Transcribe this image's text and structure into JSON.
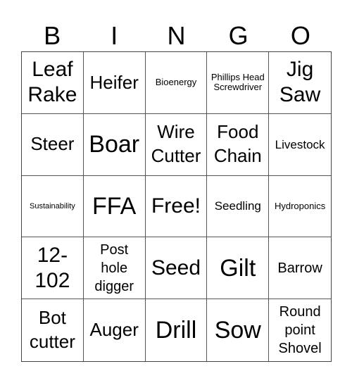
{
  "header": [
    "B",
    "I",
    "N",
    "G",
    "O"
  ],
  "cells": [
    {
      "text": "Leaf Rake",
      "size": "s-lg"
    },
    {
      "text": "Heifer",
      "size": "s-md"
    },
    {
      "text": "Bioenergy",
      "size": "s-tiny"
    },
    {
      "text": "Phillips Head Screwdriver",
      "size": "s-tiny"
    },
    {
      "text": "Jig Saw",
      "size": "s-lg"
    },
    {
      "text": "Steer",
      "size": "s-md"
    },
    {
      "text": "Boar",
      "size": "s-xl"
    },
    {
      "text": "Wire Cutter",
      "size": "s-md"
    },
    {
      "text": "Food Chain",
      "size": "s-md"
    },
    {
      "text": "Livestock",
      "size": "s-xs"
    },
    {
      "text": "Sustainability",
      "size": "s-micro"
    },
    {
      "text": "FFA",
      "size": "s-xl"
    },
    {
      "text": "Free!",
      "size": "s-lg"
    },
    {
      "text": "Seedling",
      "size": "s-xs"
    },
    {
      "text": "Hydroponics",
      "size": "s-tiny"
    },
    {
      "text": "12-102",
      "size": "s-lg"
    },
    {
      "text": "Post hole digger",
      "size": "s-sm"
    },
    {
      "text": "Seed",
      "size": "s-lg"
    },
    {
      "text": "Gilt",
      "size": "s-xl"
    },
    {
      "text": "Barrow",
      "size": "s-sm"
    },
    {
      "text": "Bot cutter",
      "size": "s-md"
    },
    {
      "text": "Auger",
      "size": "s-md"
    },
    {
      "text": "Drill",
      "size": "s-xl"
    },
    {
      "text": "Sow",
      "size": "s-xl"
    },
    {
      "text": "Round point Shovel",
      "size": "s-sm"
    }
  ]
}
